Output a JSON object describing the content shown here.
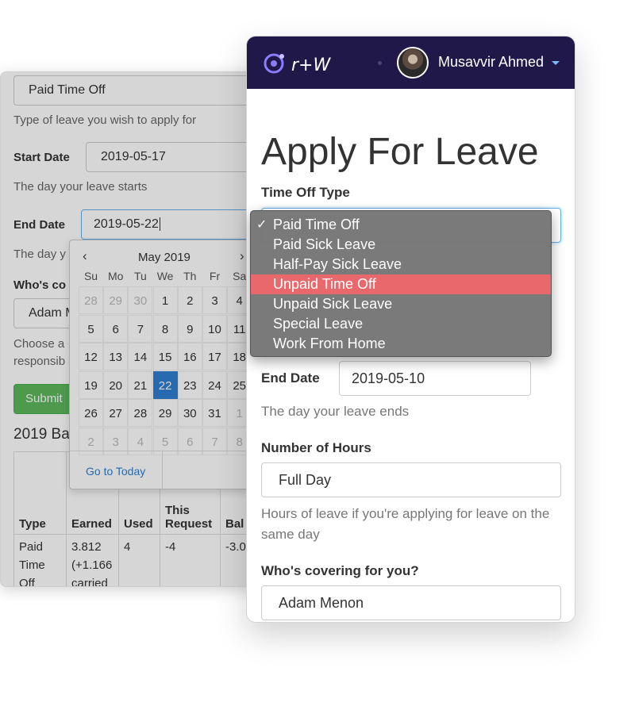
{
  "back": {
    "type_value": "Paid Time Off",
    "type_help": "Type of leave you wish to apply for",
    "start_label": "Start Date",
    "start_value": "2019-05-17",
    "start_help": "The day your leave starts",
    "end_label": "End Date",
    "end_value": "2019-05-22",
    "end_help": "The day y",
    "covering_label": "Who's co",
    "covering_value": "Adam M",
    "covering_help_1": "Choose a",
    "covering_help_2": "responsib",
    "submit_label": "Submit",
    "balances_title": "2019 Balances",
    "table": {
      "headers": [
        "Type",
        "Earned",
        "Used",
        "This Request",
        "Bal"
      ],
      "row": [
        "Paid Time Off",
        "3.812 (+1.166 carried",
        "4",
        "-4",
        "-3.0"
      ]
    }
  },
  "calendar": {
    "prev_icon": "‹",
    "next_icon": "›",
    "title": "May 2019",
    "days_of_week": [
      "Su",
      "Mo",
      "Tu",
      "We",
      "Th",
      "Fr",
      "Sa"
    ],
    "weeks": [
      [
        "28",
        "29",
        "30",
        "1",
        "2",
        "3",
        "4"
      ],
      [
        "5",
        "6",
        "7",
        "8",
        "9",
        "10",
        "11"
      ],
      [
        "12",
        "13",
        "14",
        "15",
        "16",
        "17",
        "18"
      ],
      [
        "19",
        "20",
        "21",
        "22",
        "23",
        "24",
        "25"
      ],
      [
        "26",
        "27",
        "28",
        "29",
        "30",
        "31",
        "1"
      ],
      [
        "2",
        "3",
        "4",
        "5",
        "6",
        "7",
        "8"
      ]
    ],
    "selected_day": "22",
    "go_to_today": "Go to Today"
  },
  "navbar": {
    "logo_text": "r+W",
    "user_name": "Musavvir Ahmed",
    "logo_color": "#8a7dff",
    "background": "#1f1848"
  },
  "form": {
    "page_title": "Apply For Leave",
    "time_off_label": "Time Off Type",
    "end_date_label": "End Date",
    "end_date_value": "2019-05-10",
    "end_date_help": "The day your leave ends",
    "hours_label": "Number of Hours",
    "hours_value": "Full Day",
    "hours_help": "Hours of leave if you're applying for leave on the same day",
    "covering_label": "Who's covering for you?",
    "covering_value": "Adam Menon"
  },
  "dropdown": {
    "checked_icon": "✓",
    "options": [
      "Paid Time Off",
      "Paid Sick Leave",
      "Half-Pay Sick Leave",
      "Unpaid Time Off",
      "Unpaid Sick Leave",
      "Special Leave",
      "Work From Home"
    ],
    "selected": "Paid Time Off",
    "highlighted": "Unpaid Time Off",
    "highlight_color": "#e8686c"
  }
}
